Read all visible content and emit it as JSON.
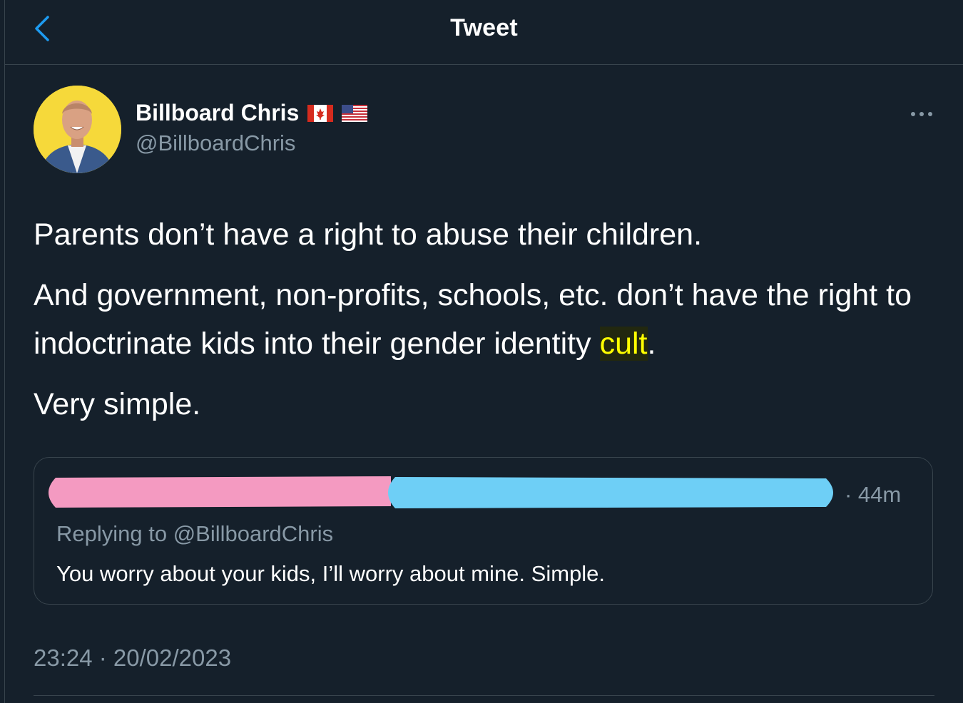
{
  "colors": {
    "background": "#15202b",
    "border": "#38444d",
    "secondary_text": "#8899a6",
    "accent_blue": "#1d9bf0",
    "highlight_text": "#ffff00"
  },
  "header": {
    "title": "Tweet",
    "back_icon": "chevron-left-icon"
  },
  "tweet": {
    "author": {
      "name": "Billboard Chris",
      "handle": "@BillboardChris",
      "flags": [
        "canada-flag-icon",
        "usa-flag-icon"
      ],
      "avatar_icon": "profile-photo"
    },
    "more_icon": "ellipsis-icon",
    "paragraphs": {
      "p1": "Parents don’t have a right to abuse their children.",
      "p2_before": "And government, non-profits, schools, etc. don’t have the right to indoctrinate kids into their gender identity ",
      "p2_highlight": "cult",
      "p2_after": ".",
      "p3": "Very simple."
    },
    "timestamp": "23:24 · 20/02/2023"
  },
  "quoted_tweet": {
    "author_redacted_colors": [
      "#f49ac1",
      "#6ecff6"
    ],
    "time": "· 44m",
    "replying_to": "Replying to @BillboardChris",
    "text": "You worry about your kids, I’ll worry about mine. Simple."
  }
}
